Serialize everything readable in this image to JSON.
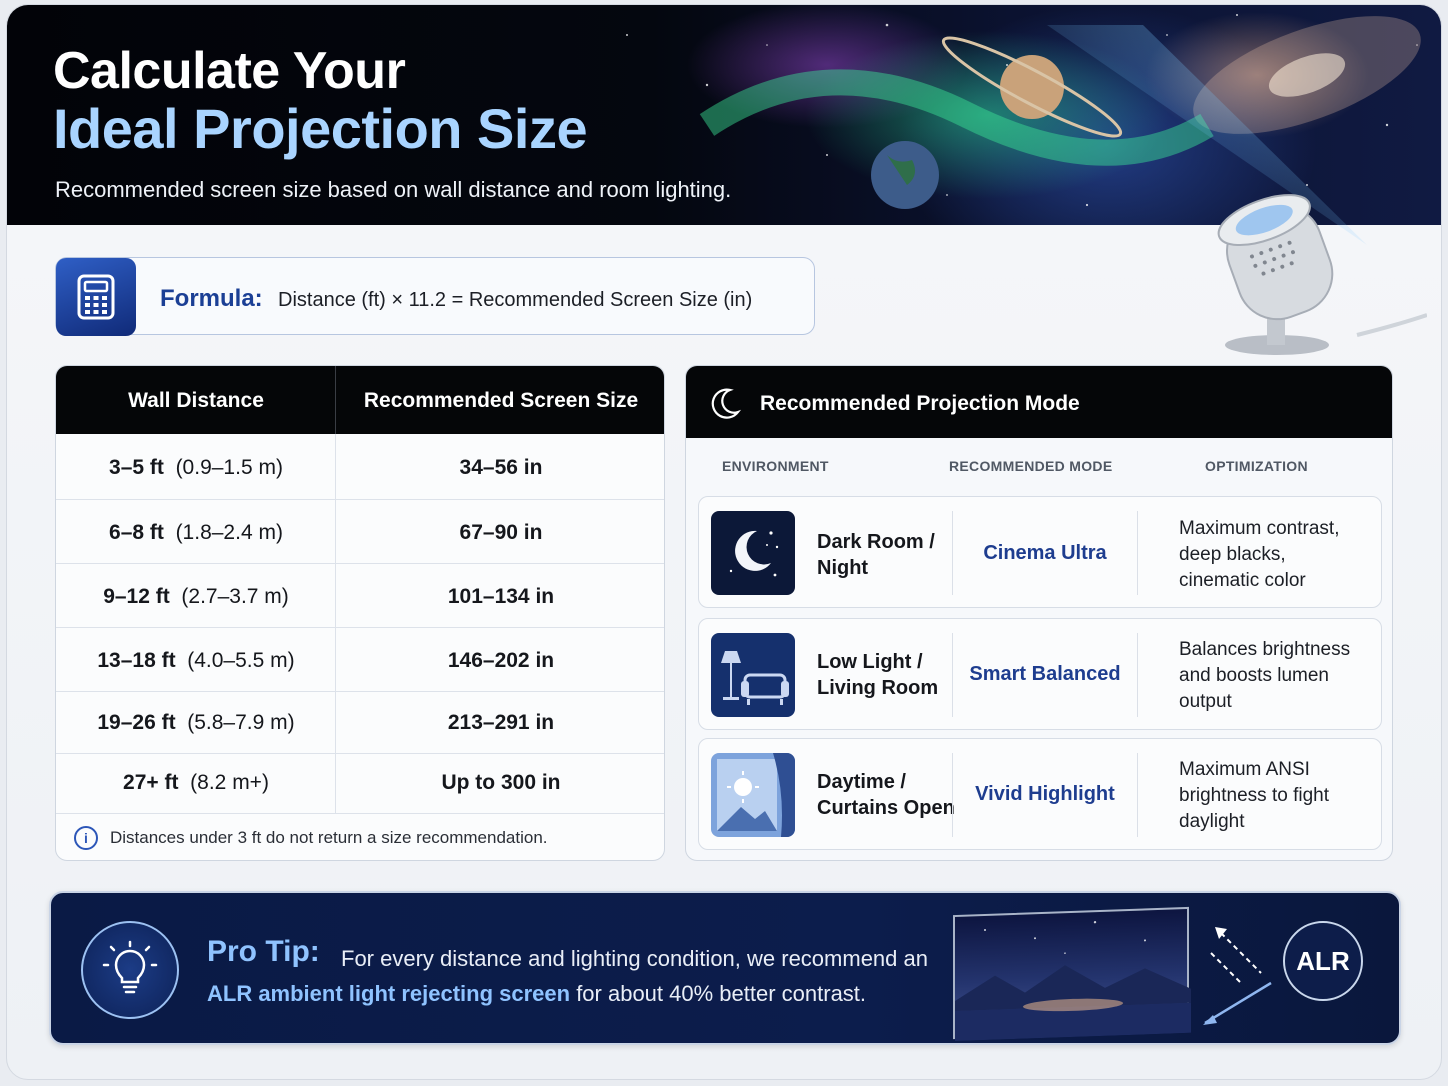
{
  "hero": {
    "title_line1": "Calculate Your",
    "title_line2": "Ideal Projection Size",
    "subtitle": "Recommended screen size based on wall distance and room lighting."
  },
  "formula": {
    "icon": "calculator-icon",
    "label": "Formula:",
    "text": "Distance (ft) × 11.2 = Recommended Screen Size (in)"
  },
  "distance_table": {
    "headers": [
      "Wall Distance",
      "Recommended Screen Size"
    ],
    "rows": [
      {
        "ft": "3–5 ft",
        "m": "(0.9–1.5 m)",
        "size": "34–56 in"
      },
      {
        "ft": "6–8 ft",
        "m": "(1.8–2.4 m)",
        "size": "67–90 in"
      },
      {
        "ft": "9–12 ft",
        "m": "(2.7–3.7 m)",
        "size": "101–134 in"
      },
      {
        "ft": "13–18 ft",
        "m": "(4.0–5.5 m)",
        "size": "146–202 in"
      },
      {
        "ft": "19–26 ft",
        "m": "(5.8–7.9 m)",
        "size": "213–291 in"
      },
      {
        "ft": "27+ ft",
        "m": "(8.2 m+)",
        "size": "Up to 300 in"
      }
    ],
    "note_icon": "info-icon",
    "note_icon_glyph": "i",
    "note": "Distances under 3 ft do not return a size recommendation."
  },
  "mode_panel": {
    "title": "Recommended Projection Mode",
    "title_icon": "moon-icon",
    "columns": [
      "ENVIRONMENT",
      "RECOMMENDED MODE",
      "OPTIMIZATION"
    ],
    "rows": [
      {
        "env_line1": "Dark Room /",
        "env_line2": "Night",
        "mode": "Cinema Ultra",
        "opt_line1": "Maximum contrast,",
        "opt_line2": "deep blacks,",
        "opt_line3": "cinematic color",
        "icon": "night-moon-icon"
      },
      {
        "env_line1": "Low Light /",
        "env_line2": "Living Room",
        "mode": "Smart Balanced",
        "opt_line1": "Balances brightness",
        "opt_line2": "and boosts lumen",
        "opt_line3": "output",
        "icon": "living-room-icon"
      },
      {
        "env_line1": "Daytime /",
        "env_line2": "Curtains Open",
        "mode": "Vivid Highlight",
        "opt_line1": "Maximum ANSI",
        "opt_line2": "brightness to fight",
        "opt_line3": "daylight",
        "icon": "daytime-window-icon"
      }
    ]
  },
  "pro_tip": {
    "icon": "lightbulb-icon",
    "label": "Pro Tip:",
    "text_before": "For every distance and lighting condition, we recommend an ",
    "highlight": "ALR ambient light rejecting screen",
    "text_after": " for about 40% better contrast.",
    "badge": "ALR"
  },
  "colors": {
    "accent_blue": "#1e3d8f",
    "highlight_blue": "#8fc3ff",
    "header_black": "#050608",
    "tip_navy": "#0a1a45"
  }
}
